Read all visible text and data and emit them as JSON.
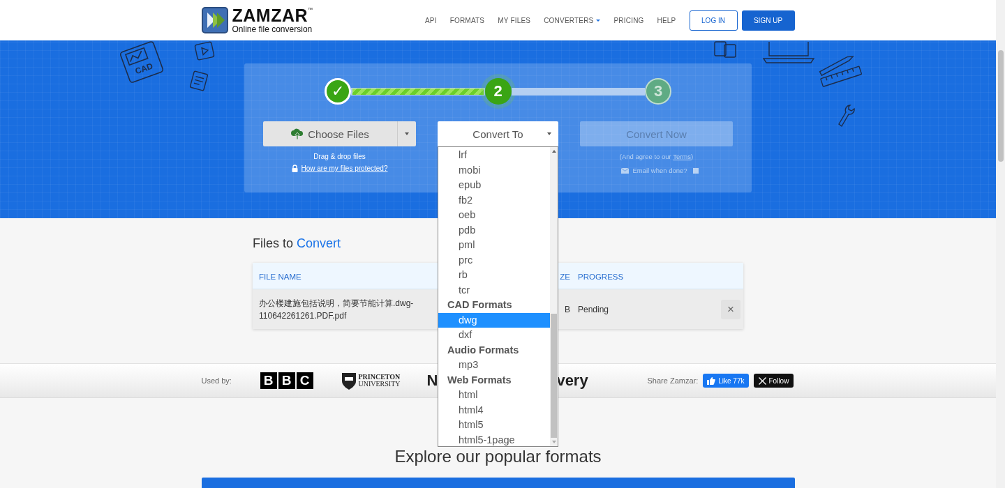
{
  "header": {
    "logo": {
      "name": "ZAMZAR",
      "mark": "™",
      "tagline": "Online file conversion"
    },
    "nav": [
      {
        "label": "API",
        "kind": "link"
      },
      {
        "label": "FORMATS",
        "kind": "link"
      },
      {
        "label": "MY FILES",
        "kind": "link"
      },
      {
        "label": "CONVERTERS",
        "kind": "dropdown"
      },
      {
        "label": "PRICING",
        "kind": "link"
      },
      {
        "label": "HELP",
        "kind": "link"
      }
    ],
    "login": "LOG IN",
    "signup": "SIGN UP"
  },
  "hero": {
    "decor_label": "CAD",
    "steps": [
      {
        "label": "✓",
        "completed": true,
        "current": false
      },
      {
        "label": "2",
        "completed": false,
        "current": true
      },
      {
        "label": "3",
        "completed": false,
        "current": false
      }
    ],
    "progress": [
      {
        "level": 1
      }
    ],
    "choose_files": {
      "label": "Choose Files",
      "hint": "Drag & drop files",
      "protected_link": "How are my files protected?"
    },
    "convert_to": {
      "label": "Convert To"
    },
    "convert_now": {
      "label": "Convert Now",
      "disabled": true,
      "terms_before": "(And agree to our ",
      "terms_link": "Terms",
      "terms_after": ")",
      "email_label": "Email when done?",
      "email_checked": false
    }
  },
  "dropdown": {
    "items": [
      {
        "kind": "option",
        "label": "lrf",
        "selected": false
      },
      {
        "kind": "option",
        "label": "mobi",
        "selected": false
      },
      {
        "kind": "option",
        "label": "epub",
        "selected": false
      },
      {
        "kind": "option",
        "label": "fb2",
        "selected": false
      },
      {
        "kind": "option",
        "label": "oeb",
        "selected": false
      },
      {
        "kind": "option",
        "label": "pdb",
        "selected": false
      },
      {
        "kind": "option",
        "label": "pml",
        "selected": false
      },
      {
        "kind": "option",
        "label": "prc",
        "selected": false
      },
      {
        "kind": "option",
        "label": "rb",
        "selected": false
      },
      {
        "kind": "option",
        "label": "tcr",
        "selected": false
      },
      {
        "kind": "group",
        "label": "CAD Formats"
      },
      {
        "kind": "option",
        "label": "dwg",
        "selected": true
      },
      {
        "kind": "option",
        "label": "dxf",
        "selected": false
      },
      {
        "kind": "group",
        "label": "Audio Formats"
      },
      {
        "kind": "option",
        "label": "mp3",
        "selected": false
      },
      {
        "kind": "group",
        "label": "Web Formats"
      },
      {
        "kind": "option",
        "label": "html",
        "selected": false
      },
      {
        "kind": "option",
        "label": "html4",
        "selected": false
      },
      {
        "kind": "option",
        "label": "html5",
        "selected": false
      },
      {
        "kind": "option",
        "label": "html5-1page",
        "selected": false
      }
    ]
  },
  "files": {
    "title": "Files to",
    "title_accent": "Convert",
    "columns": [
      "FILE NAME",
      "ZE",
      "PROGRESS"
    ],
    "rows": [
      {
        "file_name": "办公楼建施包括说明，简要节能计算.dwg-110642261261.PDF.pdf",
        "column_2": "B",
        "progress": "Pending",
        "remove": "×"
      }
    ]
  },
  "used_by": {
    "label": "Used by:",
    "logos": [
      {
        "kind": "bbc",
        "letters": [
          "B",
          "B",
          "C"
        ]
      },
      {
        "kind": "princeton",
        "text": "PRINCETON",
        "subtext": "UNIVERSITY"
      },
      {
        "kind": "plain",
        "text": "N"
      },
      {
        "kind": "plain",
        "text": "very"
      }
    ],
    "share_label": "Share Zamzar:",
    "like": "Like 77k",
    "follow": "Follow"
  },
  "explore": {
    "title": "Explore our popular formats"
  }
}
